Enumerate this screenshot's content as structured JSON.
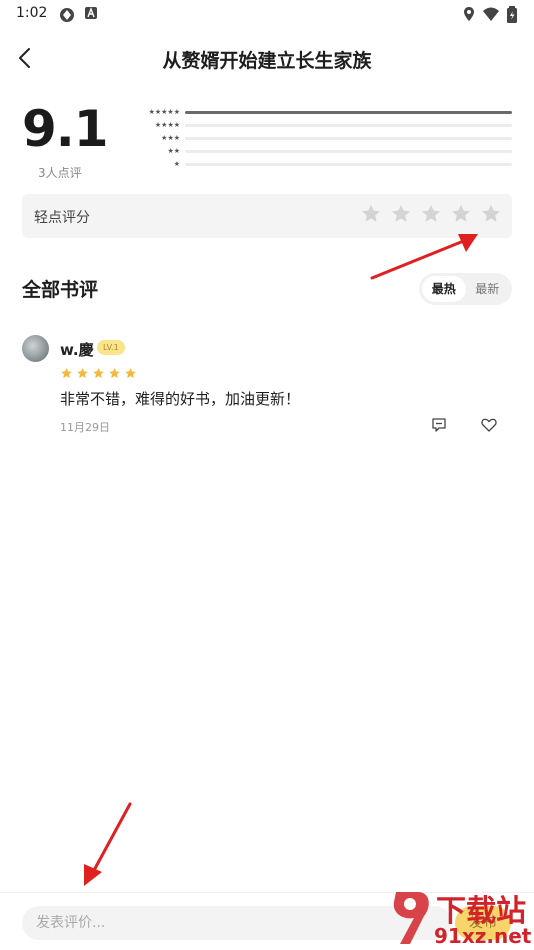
{
  "status_bar": {
    "time": "1:02"
  },
  "header": {
    "title": "从赘婿开始建立长生家族"
  },
  "rating": {
    "score": "9.1",
    "count_text": "3人点评",
    "distribution": [
      {
        "stars": "★★★★★",
        "fraction": 1.0
      },
      {
        "stars": "★★★★",
        "fraction": 0.0
      },
      {
        "stars": "★★★",
        "fraction": 0.0
      },
      {
        "stars": "★★",
        "fraction": 0.0
      },
      {
        "stars": "★",
        "fraction": 0.0
      }
    ]
  },
  "rate_box": {
    "label": "轻点评分",
    "star_count": 5
  },
  "reviews_section": {
    "title": "全部书评",
    "sort_tabs": [
      "最热",
      "最新"
    ],
    "active_sort": "最热"
  },
  "reviews": [
    {
      "username": "w.慶",
      "level": "LV.1",
      "stars": 5,
      "text": "非常不错，难得的好书，加油更新！",
      "date": "11月29日"
    }
  ],
  "bottom_bar": {
    "input_placeholder": "发表评价...",
    "publish_label": "发布"
  },
  "watermark": {
    "brand_cn": "下载站",
    "brand_url": "91xz.net"
  },
  "colors": {
    "accent_yellow": "#f7d56b",
    "star_gold": "#f5b942",
    "star_empty": "#d4d4d4",
    "annotation_red": "#e02020",
    "watermark_red": "#d2232a"
  }
}
